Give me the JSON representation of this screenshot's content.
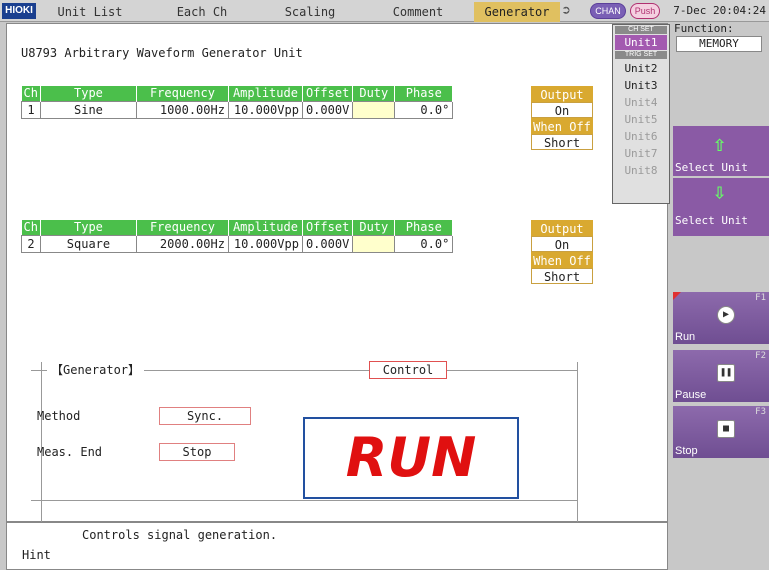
{
  "brand": "HIOKI",
  "tabs": [
    "Unit List",
    "Each Ch",
    "Scaling",
    "Comment",
    "Generator"
  ],
  "active_tab": "Generator",
  "header": {
    "chan_label": "CHAN",
    "push_label": "Push",
    "datetime": "7-Dec 20:04:24"
  },
  "unit_title": "U8793  Arbitrary Waveform Generator Unit",
  "table_headers": [
    "Ch",
    "Type",
    "Frequency",
    "Amplitude",
    "Offset",
    "Duty",
    "Phase"
  ],
  "channels": [
    {
      "ch": "1",
      "type": "Sine",
      "frequency": "1000.00Hz",
      "amplitude": "10.000Vpp",
      "offset": "0.000V",
      "duty": "",
      "phase": "0.0°",
      "output": "On",
      "when_off": "Short"
    },
    {
      "ch": "2",
      "type": "Square",
      "frequency": "2000.00Hz",
      "amplitude": "10.000Vpp",
      "offset": "0.000V",
      "duty": "",
      "phase": "0.0°",
      "output": "On",
      "when_off": "Short"
    }
  ],
  "output_labels": {
    "output": "Output",
    "when_off": "When Off"
  },
  "generator": {
    "title": "【Generator】",
    "control_label": "Control",
    "method_label": "Method",
    "method_value": "Sync.",
    "meas_end_label": "Meas. End",
    "meas_end_value": "Stop",
    "status": "RUN"
  },
  "hint": {
    "label": "Hint",
    "text": "Controls signal generation."
  },
  "function": {
    "label": "Function:",
    "value": "MEMORY"
  },
  "unit_list": {
    "chset_label": "CH SET",
    "trigset_label": "TRIG SET",
    "units": [
      "Unit1",
      "Unit2",
      "Unit3",
      "Unit4",
      "Unit5",
      "Unit6",
      "Unit7",
      "Unit8"
    ],
    "selected": "Unit1"
  },
  "right_buttons": {
    "select_unit_up": "Select Unit",
    "select_unit_down": "Select Unit",
    "f1": {
      "key": "F1",
      "label": "Run"
    },
    "f2": {
      "key": "F2",
      "label": "Pause"
    },
    "f3": {
      "key": "F3",
      "label": "Stop"
    }
  }
}
